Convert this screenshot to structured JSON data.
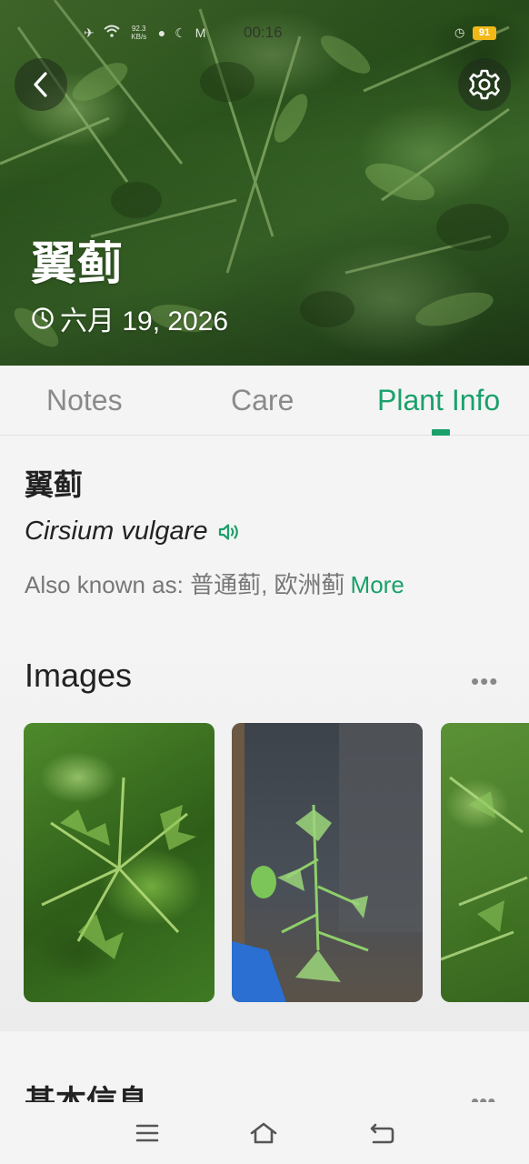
{
  "status_bar": {
    "network_speed": "92.3\nKB/s",
    "time": "00:16",
    "battery": "91"
  },
  "header": {
    "plant_name": "翼蓟",
    "date": "六月 19, 2026"
  },
  "tabs": [
    {
      "label": "Notes",
      "active": false
    },
    {
      "label": "Care",
      "active": false
    },
    {
      "label": "Plant Info",
      "active": true
    }
  ],
  "info": {
    "common_name": "翼蓟",
    "scientific_name": "Cirsium vulgare",
    "also_known_as": "Also known as: 普通蓟, 欧洲蓟",
    "more_label": "More"
  },
  "images_section": {
    "title": "Images",
    "more_icon": "more-dots-icon"
  },
  "basic_section": {
    "title": "基本信息"
  },
  "colors": {
    "accent": "#1aa06b",
    "battery": "#f2b818"
  }
}
